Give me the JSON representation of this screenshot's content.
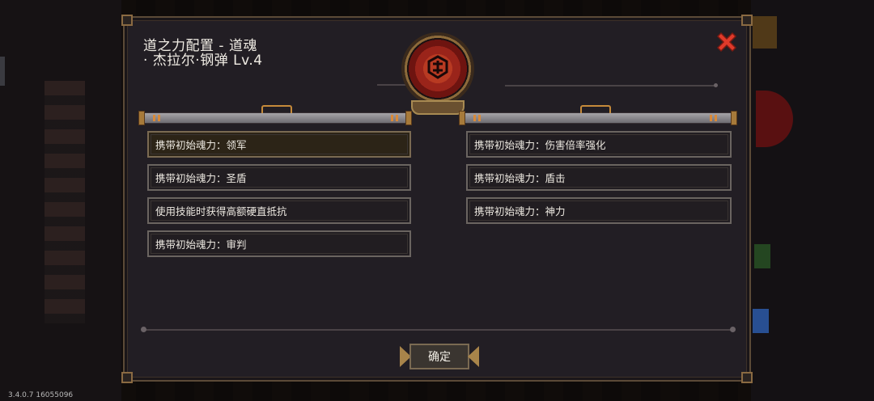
{
  "dialog": {
    "title_line1": "道之力配置 - 道魂",
    "title_line2": "· 杰拉尔·钢弹 Lv.4",
    "close_icon": "red-x-icon",
    "emblem_icon": "red-crest-emblem-icon"
  },
  "left_options": [
    {
      "label": "携带初始魂力：领军",
      "selected": true
    },
    {
      "label": "携带初始魂力：圣盾",
      "selected": false
    },
    {
      "label": "使用技能时获得高额硬直抵抗",
      "selected": false
    },
    {
      "label": "携带初始魂力：审判",
      "selected": false
    }
  ],
  "right_options": [
    {
      "label": "携带初始魂力：伤害倍率强化",
      "selected": false
    },
    {
      "label": "携带初始魂力：盾击",
      "selected": false
    },
    {
      "label": "携带初始魂力：神力",
      "selected": false
    }
  ],
  "confirm_label": "确定",
  "version_text": "3.4.0.7 16055096",
  "colors": {
    "panel_bg": "#221e24",
    "border_gold": "#8a6a42",
    "selected_bg": "#2c2417",
    "close_red": "#d9392b"
  }
}
